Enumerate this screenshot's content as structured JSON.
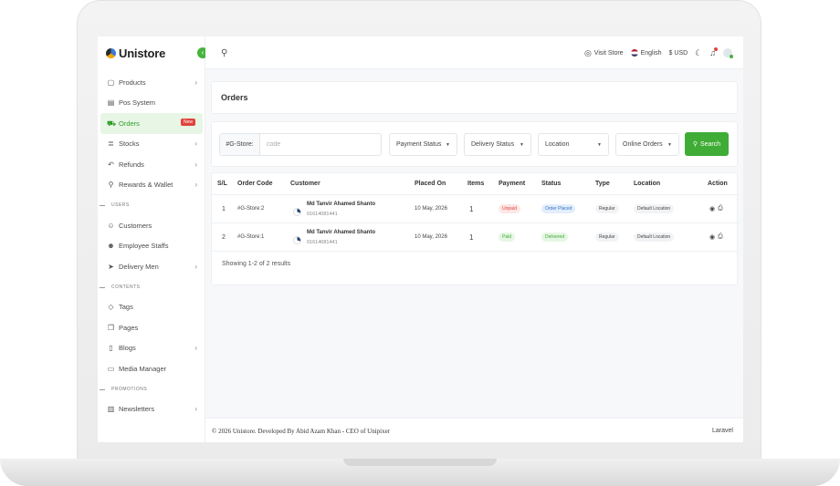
{
  "brand": {
    "name": "Unistore"
  },
  "sidebar": {
    "items": [
      {
        "label": "Products",
        "icon": "box-icon",
        "chevron": true
      },
      {
        "label": "Pos System",
        "icon": "pos-icon",
        "chevron": false
      },
      {
        "label": "Orders",
        "icon": "cart-icon",
        "chevron": false,
        "active": true,
        "badge": "New"
      },
      {
        "label": "Stocks",
        "icon": "stack-icon",
        "chevron": true
      },
      {
        "label": "Refunds",
        "icon": "undo-icon",
        "chevron": true
      },
      {
        "label": "Rewards & Wallet",
        "icon": "award-icon",
        "chevron": true
      }
    ],
    "sections": [
      {
        "label": "USERS",
        "items": [
          {
            "label": "Customers",
            "icon": "users-icon",
            "chevron": false
          },
          {
            "label": "Employee Staffs",
            "icon": "user-check-icon",
            "chevron": false
          },
          {
            "label": "Delivery Men",
            "icon": "send-icon",
            "chevron": true
          }
        ]
      },
      {
        "label": "CONTENTS",
        "items": [
          {
            "label": "Tags",
            "icon": "tag-icon",
            "chevron": false
          },
          {
            "label": "Pages",
            "icon": "copy-icon",
            "chevron": false
          },
          {
            "label": "Blogs",
            "icon": "file-icon",
            "chevron": true
          },
          {
            "label": "Media Manager",
            "icon": "folder-icon",
            "chevron": false
          }
        ]
      },
      {
        "label": "PROMOTIONS",
        "items": [
          {
            "label": "Newsletters",
            "icon": "map-icon",
            "chevron": true
          }
        ]
      }
    ]
  },
  "header": {
    "visit_store": "Visit Store",
    "language": "English",
    "currency": "$ USD"
  },
  "page": {
    "title": "Orders"
  },
  "filters": {
    "store_prefix": "#G-Store:",
    "code_placeholder": "code",
    "payment_status": "Payment Status",
    "delivery_status": "Delivery Status",
    "location": "Location",
    "order_source": "Online Orders",
    "search_label": "Search"
  },
  "table": {
    "headers": [
      "S/L",
      "Order Code",
      "Customer",
      "Placed On",
      "Items",
      "Payment",
      "Status",
      "Type",
      "Location",
      "Action"
    ],
    "rows": [
      {
        "sl": "1",
        "code": "#G-Store:2",
        "name": "Md Tanvir Ahamed Shanto",
        "phone": "01614081441",
        "placed": "10 May, 2026",
        "items": "1",
        "payment": "Unpaid",
        "status": "Order Placed",
        "type": "Regular",
        "location": "Default Location"
      },
      {
        "sl": "2",
        "code": "#G-Store:1",
        "name": "Md Tanvir Ahamed Shanto",
        "phone": "01614081441",
        "placed": "10 May, 2026",
        "items": "1",
        "payment": "Paid",
        "status": "Delivered",
        "type": "Regular",
        "location": "Default Location"
      }
    ],
    "showing": "Showing 1-2 of 2 results"
  },
  "footer": {
    "copyright": "© 2026 Unistore. Developed By Abid Azam Khan - CEO of Unipixer",
    "right": "Laravel"
  },
  "colors": {
    "accent": "#3fac36",
    "danger": "#e0433c",
    "info": "#3672c4"
  }
}
